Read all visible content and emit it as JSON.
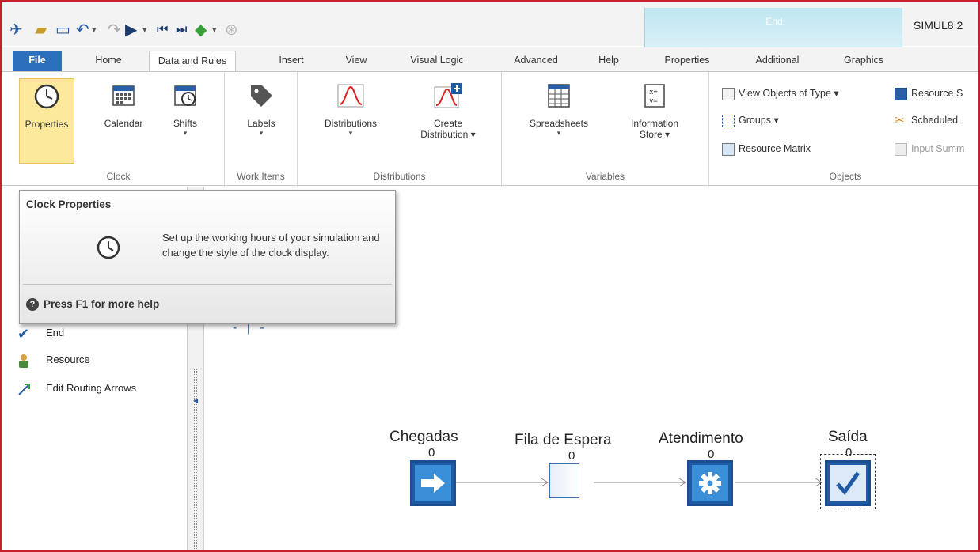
{
  "app": {
    "title": "SIMUL8 2",
    "context_tab": "End"
  },
  "tabs": [
    {
      "label": "File"
    },
    {
      "label": "Home"
    },
    {
      "label": "Data and Rules"
    },
    {
      "label": "Insert"
    },
    {
      "label": "View"
    },
    {
      "label": "Visual Logic"
    },
    {
      "label": "Advanced"
    },
    {
      "label": "Help"
    },
    {
      "label": "Properties"
    },
    {
      "label": "Additional"
    },
    {
      "label": "Graphics"
    }
  ],
  "ribbon": {
    "clock": {
      "label": "Clock",
      "properties": "Properties",
      "calendar": "Calendar",
      "shifts": "Shifts"
    },
    "work_items": {
      "label": "Work Items",
      "labels": "Labels"
    },
    "distributions": {
      "label": "Distributions",
      "distributions": "Distributions",
      "create_line1": "Create",
      "create_line2": "Distribution ▾"
    },
    "variables": {
      "label": "Variables",
      "spreadsheets": "Spreadsheets",
      "info_line1": "Information",
      "info_line2": "Store ▾"
    },
    "objects": {
      "label": "Objects",
      "view_objects": "View Objects of Type ▾",
      "groups": "Groups ▾",
      "resource_matrix": "Resource Matrix",
      "resource_s": "Resource S",
      "scheduled": "Scheduled",
      "input_summ": "Input Summ"
    }
  },
  "panel": {
    "items": [
      {
        "label": "End"
      },
      {
        "label": "Resource"
      },
      {
        "label": "Edit Routing Arrows"
      }
    ]
  },
  "tooltip": {
    "title": "Clock Properties",
    "body": "Set up the working hours of your simulation and change the style of the clock display.",
    "help": "Press F1 for more help"
  },
  "model": {
    "objects": [
      {
        "label": "Chegadas",
        "count": "0",
        "kind": "arrival"
      },
      {
        "label": "Fila de Espera",
        "count": "0",
        "kind": "queue"
      },
      {
        "label": "Atendimento",
        "count": "0",
        "kind": "activity"
      },
      {
        "label": "Saída",
        "count": "0",
        "kind": "end"
      }
    ]
  },
  "colors": {
    "accent": "#2c6fbb",
    "object_blue": "#1f5aa5",
    "highlight": "#fde99b",
    "frame": "#c8202a"
  }
}
